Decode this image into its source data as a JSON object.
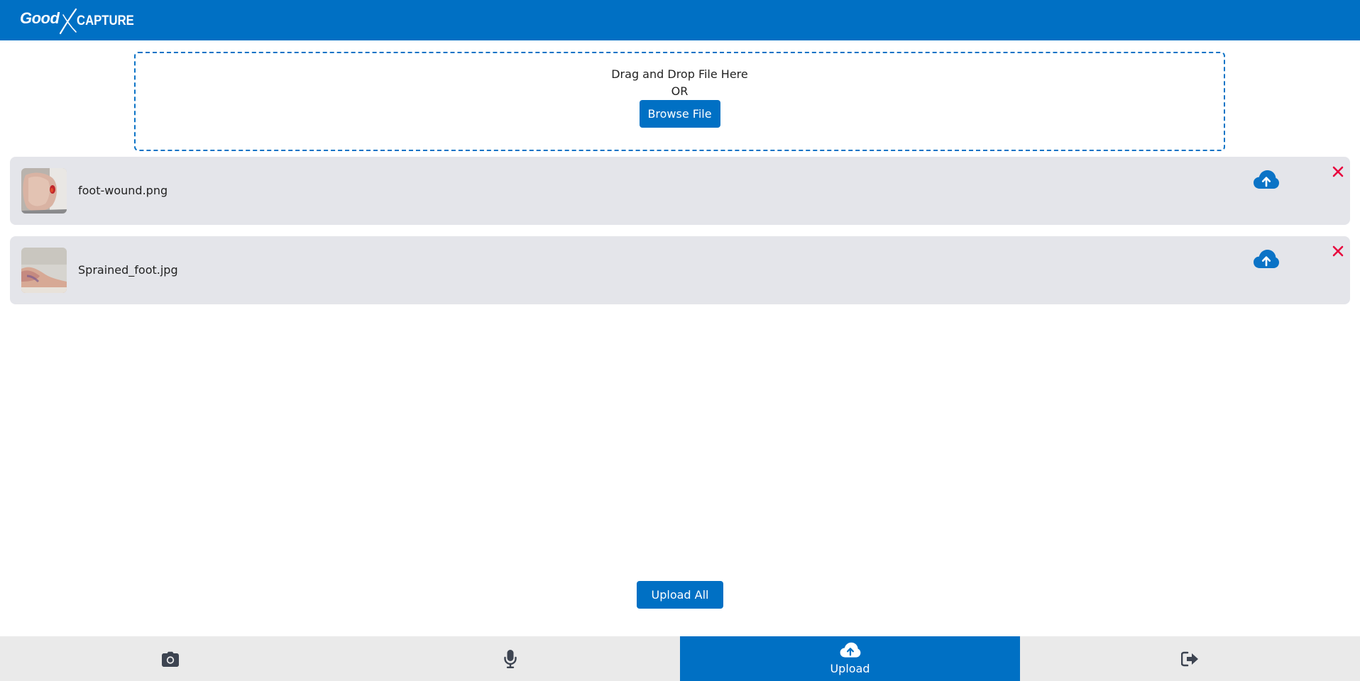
{
  "header": {
    "logo_good": "Good",
    "logo_capture": "CAPTURE"
  },
  "dropzone": {
    "drag_text": "Drag and Drop File Here",
    "or_text": "OR",
    "browse_label": "Browse File"
  },
  "files": [
    {
      "name": "foot-wound.png",
      "thumb_icon": "foot-wound-thumbnail",
      "upload_icon": "cloud-upload-icon",
      "remove_icon": "close-icon"
    },
    {
      "name": "Sprained_foot.jpg",
      "thumb_icon": "sprained-foot-thumbnail",
      "upload_icon": "cloud-upload-icon",
      "remove_icon": "close-icon"
    }
  ],
  "upload_all_label": "Upload All",
  "nav": {
    "items": [
      {
        "icon": "camera-icon",
        "label": ""
      },
      {
        "icon": "microphone-icon",
        "label": ""
      },
      {
        "icon": "cloud-upload-icon",
        "label": "Upload",
        "active": true
      },
      {
        "icon": "logout-icon",
        "label": ""
      }
    ]
  },
  "colors": {
    "primary": "#0070c4",
    "row_background": "#e4e5ea",
    "remove": "#e8003d",
    "nav_background": "#eaeaea",
    "nav_icon": "#3d4451"
  }
}
